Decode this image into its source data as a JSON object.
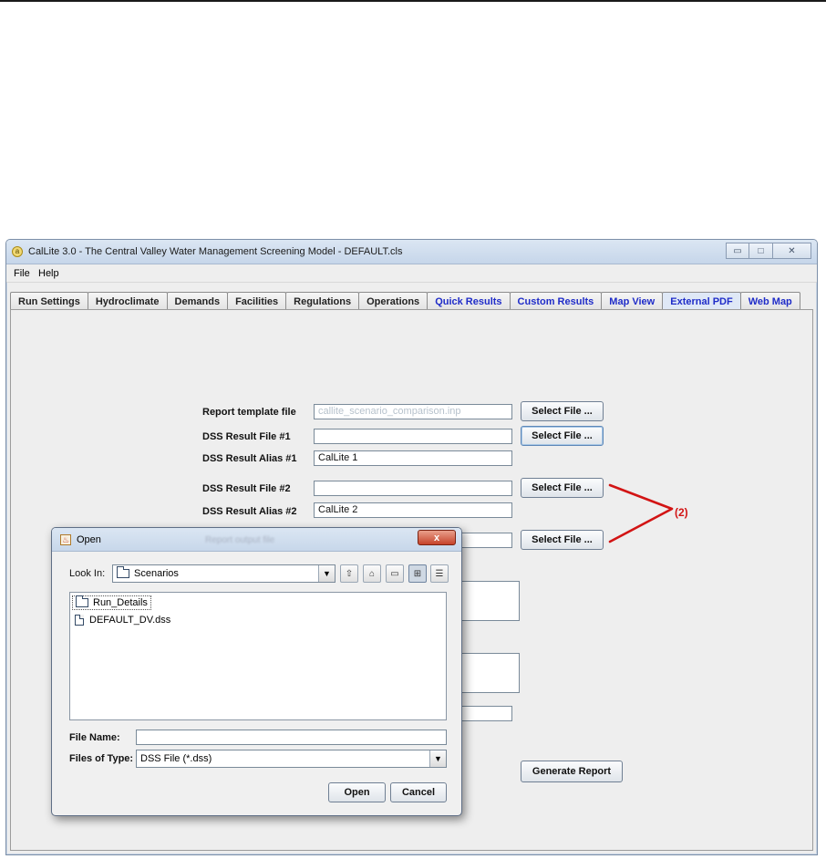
{
  "window": {
    "title": "CalLite 3.0 -  The Central Valley Water Management Screening Model - DEFAULT.cls",
    "icon": "a",
    "minimize": "▭",
    "maximize": "□",
    "close": "✕"
  },
  "menu": {
    "file": "File",
    "help": "Help"
  },
  "tabs": [
    {
      "label": "Run Settings"
    },
    {
      "label": "Hydroclimate"
    },
    {
      "label": "Demands"
    },
    {
      "label": "Facilities"
    },
    {
      "label": "Regulations"
    },
    {
      "label": "Operations"
    },
    {
      "label": "Quick Results"
    },
    {
      "label": "Custom Results"
    },
    {
      "label": "Map View"
    },
    {
      "label": "External PDF"
    },
    {
      "label": "Web Map"
    }
  ],
  "form": {
    "template_label": "Report template file",
    "template_value": "callite_scenario_comparison.inp",
    "dss1_label": "DSS Result File #1",
    "dss1_value": "",
    "alias1_label": "DSS Result Alias #1",
    "alias1_value": "CalLite 1",
    "dss2_label": "DSS Result File #2",
    "dss2_value": "",
    "alias2_label": "DSS Result Alias #2",
    "alias2_value": "CalLite 2",
    "output_label": "Report output file",
    "select_label": "Select File ...",
    "generate_label": "Generate Report"
  },
  "annotation": {
    "text": "(2)",
    "color": "#d21414"
  },
  "dialog": {
    "title": "Open",
    "ghost_label": "Report output file",
    "close": "x",
    "look_in_label": "Look In:",
    "look_in_value": "Scenarios",
    "files": [
      {
        "name": "Run_Details",
        "type": "folder-icon"
      },
      {
        "name": "DEFAULT_DV.dss",
        "type": "file-icon"
      }
    ],
    "file_name_label": "File Name:",
    "file_name_value": "",
    "files_of_type_label": "Files of Type:",
    "files_of_type_value": "DSS File (*.dss)",
    "open_label": "Open",
    "cancel_label": "Cancel"
  }
}
